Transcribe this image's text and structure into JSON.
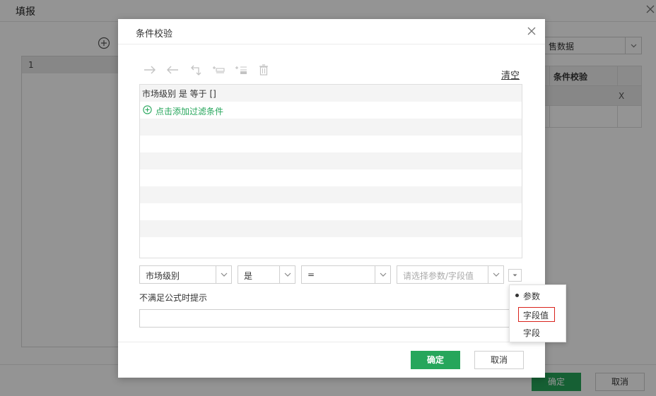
{
  "outer": {
    "title": "填报",
    "row_number": "1",
    "select_value": "售数据",
    "table_header": "条件校验",
    "table_cell_x": "X",
    "ok_label": "确定",
    "cancel_label": "取消"
  },
  "dialog": {
    "title": "条件校验",
    "clear_label": "清空",
    "condition_text": "市场级别 是 等于 []",
    "add_filter_label": "点击添加过滤条件",
    "field_select": "市场级别",
    "is_select": "是",
    "operator_select": "=",
    "value_placeholder": "请选择参数/字段值",
    "prompt_label": "不满足公式时提示",
    "prompt_value": "",
    "ok_label": "确定",
    "cancel_label": "取消"
  },
  "mode_menu": {
    "items": [
      "参数",
      "字段值",
      "字段"
    ],
    "selected": "参数",
    "highlighted": "字段值"
  },
  "colors": {
    "accent": "#26a65b",
    "highlight_border": "#d9231c"
  },
  "icons": {
    "toolbar": [
      "arrow-right-icon",
      "arrow-left-icon",
      "return-icon",
      "add-row-icon",
      "insert-row-icon",
      "delete-icon"
    ]
  }
}
